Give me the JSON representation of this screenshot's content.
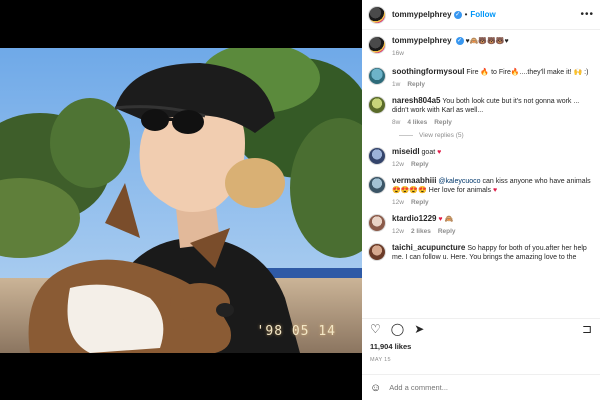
{
  "post": {
    "username": "tommypelphrey",
    "follow_label": "Follow",
    "caption_emojis": "♥🙈🐻🐻🐻♥",
    "caption_time": "16w",
    "photo_stamp": "'98 05 14",
    "likes": "11,904 likes",
    "date": "MAY 15",
    "add_comment_placeholder": "Add a comment..."
  },
  "comments": [
    {
      "username": "soothingformysoul",
      "text": "Fire 🔥 to Fire🔥....they'll make it! 🙌 :)",
      "time": "1w",
      "likes": "",
      "reply_label": "Reply"
    },
    {
      "username": "naresh804a5",
      "text": "You both look cute but it's not gonna work ... didn't work with Karl as well...",
      "time": "8w",
      "likes": "4 likes",
      "reply_label": "Reply",
      "view_replies": "View replies (5)"
    },
    {
      "username": "miseidl",
      "text": "goat",
      "time": "12w",
      "likes": "",
      "reply_label": "Reply"
    },
    {
      "username": "vermaabhiii",
      "mention": "@kaleycuoco",
      "text": " can kiss anyone who have animals 😍😍😍😍 Her love for animals",
      "time": "12w",
      "likes": "",
      "reply_label": "Reply"
    },
    {
      "username": "ktardio1229",
      "text": "",
      "time": "12w",
      "likes": "2 likes",
      "reply_label": "Reply"
    },
    {
      "username": "taichi_acupuncture",
      "text": "So happy for both of you.after her help me. I can follow u. Here. You brings the amazing love to the",
      "time": "",
      "likes": "",
      "reply_label": ""
    }
  ],
  "icons": {
    "more": "more-options-icon",
    "heart": "heart-icon",
    "comment": "comment-icon",
    "share": "share-icon",
    "save": "bookmark-icon",
    "emoji": "emoji-icon"
  },
  "colors": {
    "accent": "#0095f6",
    "verified": "#3897f0",
    "heart": "#e11d48",
    "muted": "#8e8e8e"
  }
}
